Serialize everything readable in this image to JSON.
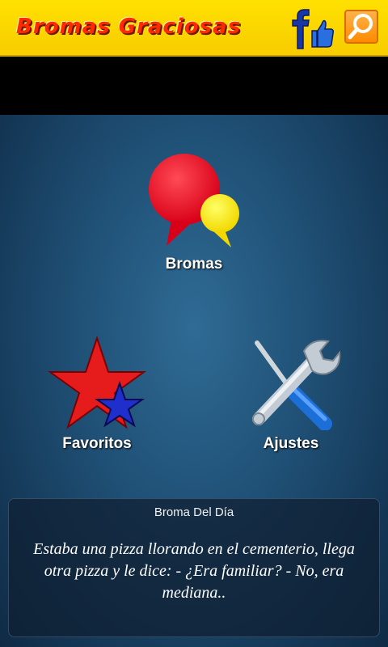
{
  "app": {
    "title": "Bromas Graciosas"
  },
  "header": {
    "facebook_icon": "facebook-like-icon",
    "search_icon": "search-icon"
  },
  "menu": {
    "bromas": {
      "label": "Bromas",
      "icon": "speech-bubbles-icon"
    },
    "favoritos": {
      "label": "Favoritos",
      "icon": "stars-icon"
    },
    "ajustes": {
      "label": "Ajustes",
      "icon": "tools-icon"
    }
  },
  "joke_of_day": {
    "title": "Broma Del Día",
    "text": "Estaba una pizza llorando en el cementerio, llega otra pizza y le dice: - ¿Era familiar? - No, era mediana.."
  },
  "colors": {
    "topbar": "#ffe100",
    "title_text": "#ff2a00",
    "background_blue": "#1f4f74",
    "bubble_red": "#ee1122",
    "bubble_yellow": "#ffee00",
    "star_red": "#e61b1b",
    "star_blue": "#1f2fcc"
  }
}
